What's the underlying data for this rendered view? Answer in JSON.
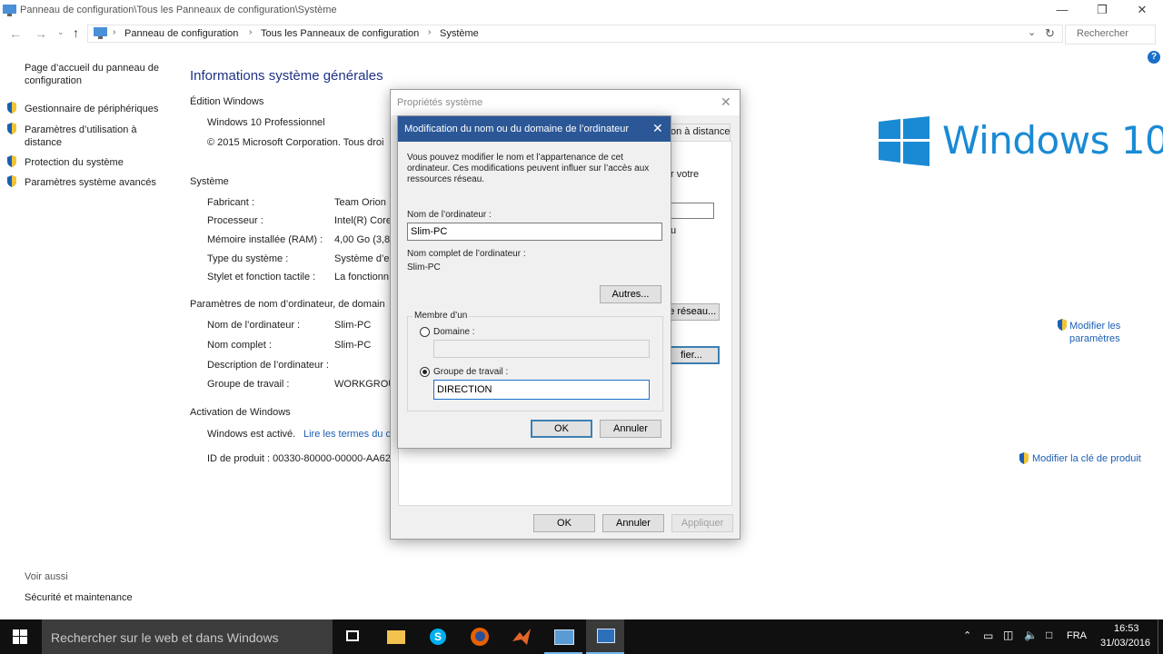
{
  "window": {
    "title": "Panneau de configuration\\Tous les Panneaux de configuration\\Système",
    "breadcrumb": [
      "Panneau de configuration",
      "Tous les Panneaux de configuration",
      "Système"
    ],
    "search_placeholder": "Rechercher"
  },
  "left_pane": {
    "home": "Page d’accueil du panneau de configuration",
    "items": [
      "Gestionnaire de périphériques",
      "Paramètres d’utilisation à distance",
      "Protection du système",
      "Paramètres système avancés"
    ],
    "see_also_title": "Voir aussi",
    "see_also_item": "Sécurité et maintenance"
  },
  "main": {
    "heading": "Informations système générales",
    "edition_section": "Édition Windows",
    "edition": "Windows 10 Professionnel",
    "copyright": "© 2015 Microsoft Corporation. Tous droi",
    "system_section": "Système",
    "system_rows": [
      {
        "label": "Fabricant :",
        "value": "Team Orion"
      },
      {
        "label": "Processeur :",
        "value": "Intel(R) Core"
      },
      {
        "label": "Mémoire installée (RAM) :",
        "value": "4,00 Go (3,87"
      },
      {
        "label": "Type du système :",
        "value": "Système d’e"
      },
      {
        "label": "Stylet et fonction tactile :",
        "value": "La fonctionn"
      }
    ],
    "name_section": "Paramètres de nom d’ordinateur, de domain",
    "name_rows": [
      {
        "label": "Nom de l’ordinateur :",
        "value": "Slim-PC"
      },
      {
        "label": "Nom complet :",
        "value": "Slim-PC"
      },
      {
        "label": "Description de l’ordinateur :",
        "value": ""
      },
      {
        "label": "Groupe de travail :",
        "value": "WORKGROU"
      }
    ],
    "activation_section": "Activation de Windows",
    "activated": "Windows est activé.",
    "license_link": "Lire les termes du c",
    "product_id": "ID de produit : 00330-80000-00000-AA62",
    "change_settings": "Modifier les paramètres",
    "change_key": "Modifier la clé de produit",
    "logo_text": "Windows 10"
  },
  "sysprops": {
    "title": "Propriétés système",
    "tab_remote": "on à distance",
    "tab_partial": "el",
    "text_partial": "r votre",
    "text_partial2": "u",
    "network_btn": "le réseau...",
    "modify_btn": "fier...",
    "ok": "OK",
    "cancel": "Annuler",
    "apply": "Appliquer"
  },
  "rename": {
    "title": "Modification du nom ou du domaine de l’ordinateur",
    "description": "Vous pouvez modifier le nom et l’appartenance de cet ordinateur. Ces modifications peuvent influer sur l’accès aux ressources réseau.",
    "computer_name_label": "Nom de l’ordinateur :",
    "computer_name_value": "Slim-PC",
    "full_name_label": "Nom complet de l’ordinateur :",
    "full_name_value": "Slim-PC",
    "more_btn": "Autres...",
    "member_of": "Membre d’un",
    "domain_label": "Domaine :",
    "workgroup_label": "Groupe de travail :",
    "workgroup_value": "DIRECTION",
    "ok": "OK",
    "cancel": "Annuler"
  },
  "taskbar": {
    "search_placeholder": "Rechercher sur le web et dans Windows",
    "lang": "FRA",
    "time": "16:53",
    "date": "31/03/2016"
  },
  "colors": {
    "accent": "#1e3287",
    "windows_blue": "#1a8ad4",
    "taskbar": "#101010"
  }
}
